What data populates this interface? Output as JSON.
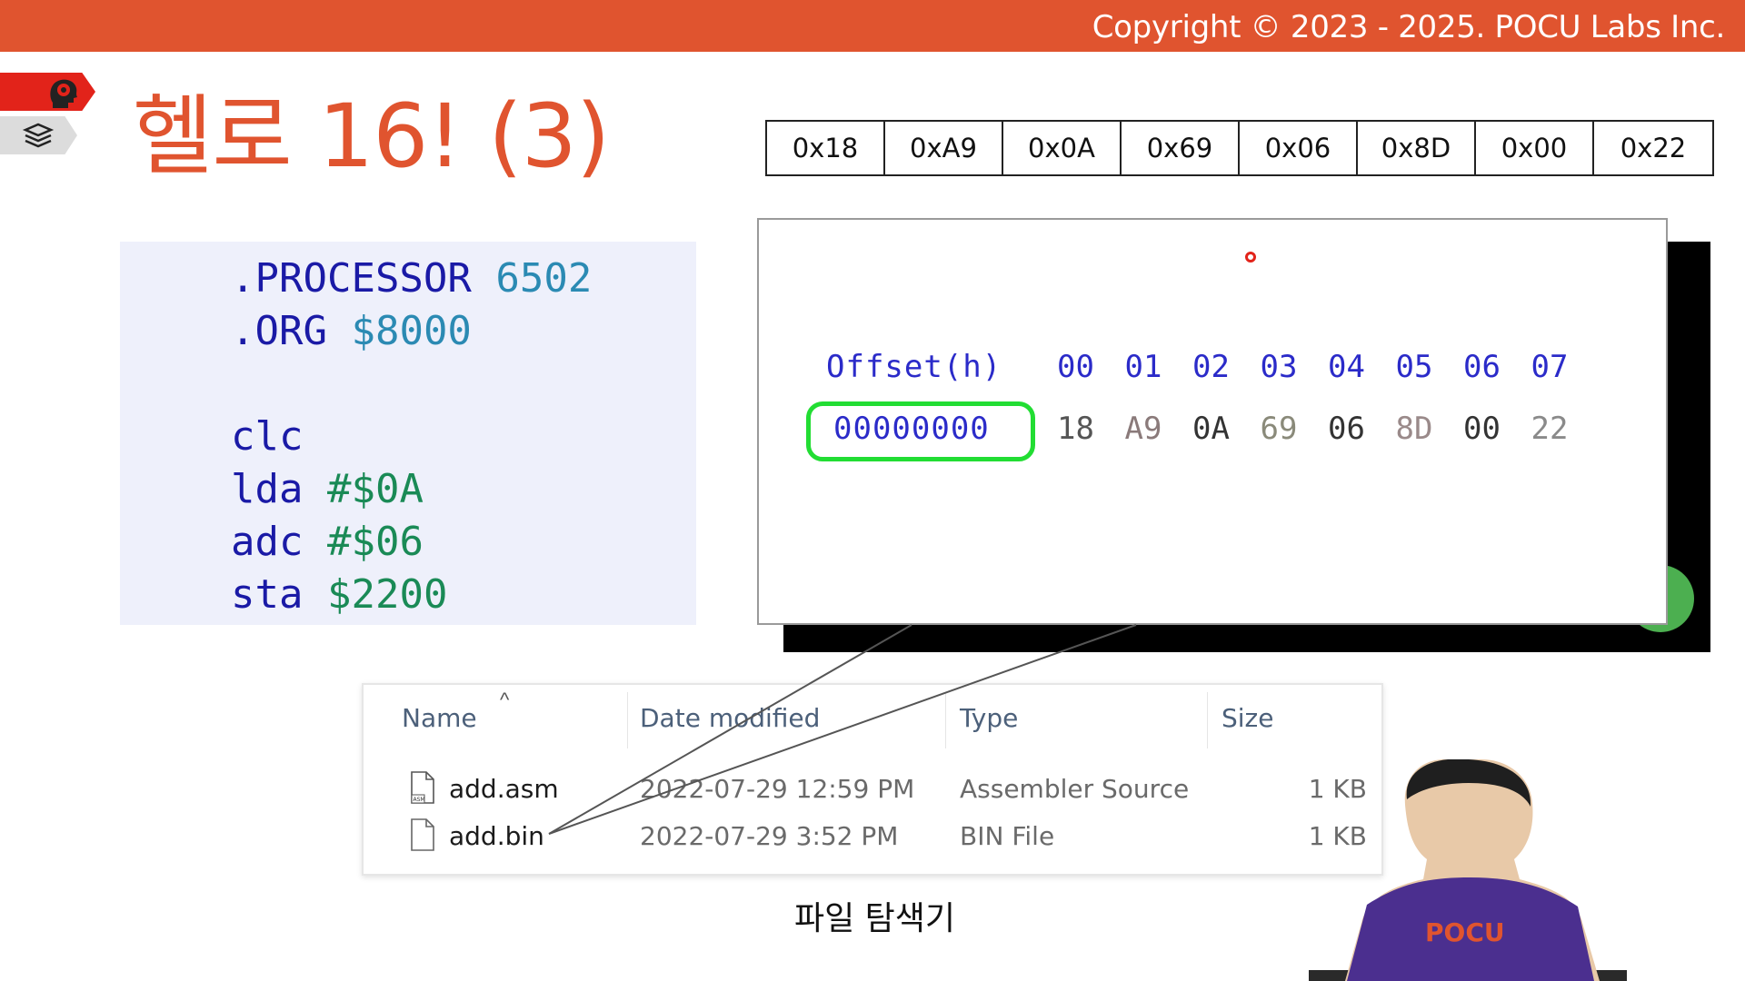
{
  "header": {
    "copyright": "Copyright © 2023 - 2025. POCU Labs Inc."
  },
  "side_tabs": [
    {
      "icon": "brain-head-icon"
    },
    {
      "icon": "stacked-books-icon"
    }
  ],
  "slide": {
    "title": "헬로 16! (3)"
  },
  "bytes": [
    "0x18",
    "0xA9",
    "0x0A",
    "0x69",
    "0x06",
    "0x8D",
    "0x00",
    "0x22"
  ],
  "code": {
    "lines": [
      {
        "op": ".PROCESSOR",
        "arg": "6502",
        "arg_style": "num"
      },
      {
        "op": ".ORG",
        "arg": "$8000",
        "arg_style": "num"
      },
      {
        "op": "",
        "arg": ""
      },
      {
        "op": "clc",
        "arg": ""
      },
      {
        "op": "lda",
        "arg": "#$0A",
        "arg_style": "imm"
      },
      {
        "op": "adc",
        "arg": "#$06",
        "arg_style": "imm"
      },
      {
        "op": "sta",
        "arg": "$2200",
        "arg_style": "imm"
      }
    ]
  },
  "hex_view": {
    "offset_label": "Offset(h)",
    "columns": [
      "00",
      "01",
      "02",
      "03",
      "04",
      "05",
      "06",
      "07"
    ],
    "row_address": "00000000",
    "values": [
      "18",
      "A9",
      "0A",
      "69",
      "06",
      "8D",
      "00",
      "22"
    ],
    "value_colors": [
      "#555555",
      "#8a7a7a",
      "#333333",
      "#8a8a7a",
      "#333333",
      "#9a8a8a",
      "#333333",
      "#8a8a8a"
    ],
    "highlight_color": "#22dd33"
  },
  "explorer": {
    "columns": {
      "name": "Name",
      "date": "Date modified",
      "type": "Type",
      "size": "Size"
    },
    "files": [
      {
        "name": "add.asm",
        "date": "2022-07-29 12:59 PM",
        "type": "Assembler Source",
        "size": "1 KB",
        "icon": "asm-file-icon"
      },
      {
        "name": "add.bin",
        "date": "2022-07-29 3:52 PM",
        "type": "BIN File",
        "size": "1 KB",
        "icon": "blank-file-icon"
      }
    ]
  },
  "caption": "파일 탐색기",
  "colors": {
    "accent": "#e0542f",
    "code_bg": "#eef0fb",
    "hex_blue": "#2b2bc9"
  }
}
